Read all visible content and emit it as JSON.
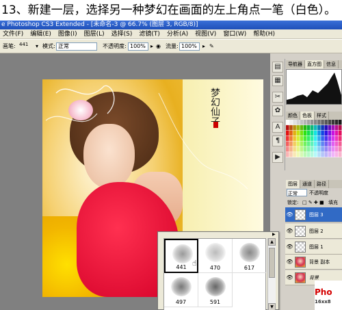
{
  "banner": {
    "text": "13、新建一层，选择另一种梦幻在画面的左上角点一笔（白色）。"
  },
  "titlebar": {
    "text": "e Photoshop CS3 Extended - [未命名-3 @ 66.7% (图层 3, RGB/8)]"
  },
  "menubar": {
    "items": [
      "文件(F)",
      "编辑(E)",
      "图像(I)",
      "图层(L)",
      "选择(S)",
      "滤镜(T)",
      "分析(A)",
      "视图(V)",
      "窗口(W)",
      "帮助(H)"
    ]
  },
  "options": {
    "brush_label": "画笔:",
    "brush_size": "441",
    "mode_label": "模式:",
    "mode_value": "正常",
    "opacity_label": "不透明度:",
    "opacity_value": "100%",
    "flow_label": "流量:",
    "flow_value": "100%"
  },
  "canvas": {
    "calligraphy": "梦幻仙子"
  },
  "panels": {
    "top_tabs": [
      "导航器",
      "直方图",
      "信息"
    ],
    "mid_tabs": [
      "颜色",
      "色板",
      "样式"
    ],
    "layer_tabs": [
      "图层",
      "通道",
      "路径"
    ],
    "blend_mode": "正常",
    "opacity_label": "不透明度",
    "lock_label": "锁定:",
    "fill_label": "填充",
    "layers": [
      {
        "name": "图层 3",
        "selected": true,
        "photo": false
      },
      {
        "name": "图层 2",
        "selected": false,
        "photo": false
      },
      {
        "name": "图层 1",
        "selected": false,
        "photo": false
      },
      {
        "name": "背景 副本",
        "selected": false,
        "photo": true
      },
      {
        "name": "背景",
        "selected": false,
        "photo": true
      }
    ]
  },
  "brush_picker": {
    "brushes": [
      {
        "size": "441",
        "selected": true
      },
      {
        "size": "470",
        "selected": false
      },
      {
        "size": "617",
        "selected": false
      },
      {
        "size": "497",
        "selected": false
      },
      {
        "size": "591",
        "selected": false
      }
    ]
  },
  "watermark": {
    "line1": "Pho",
    "line2": "16xx8"
  }
}
